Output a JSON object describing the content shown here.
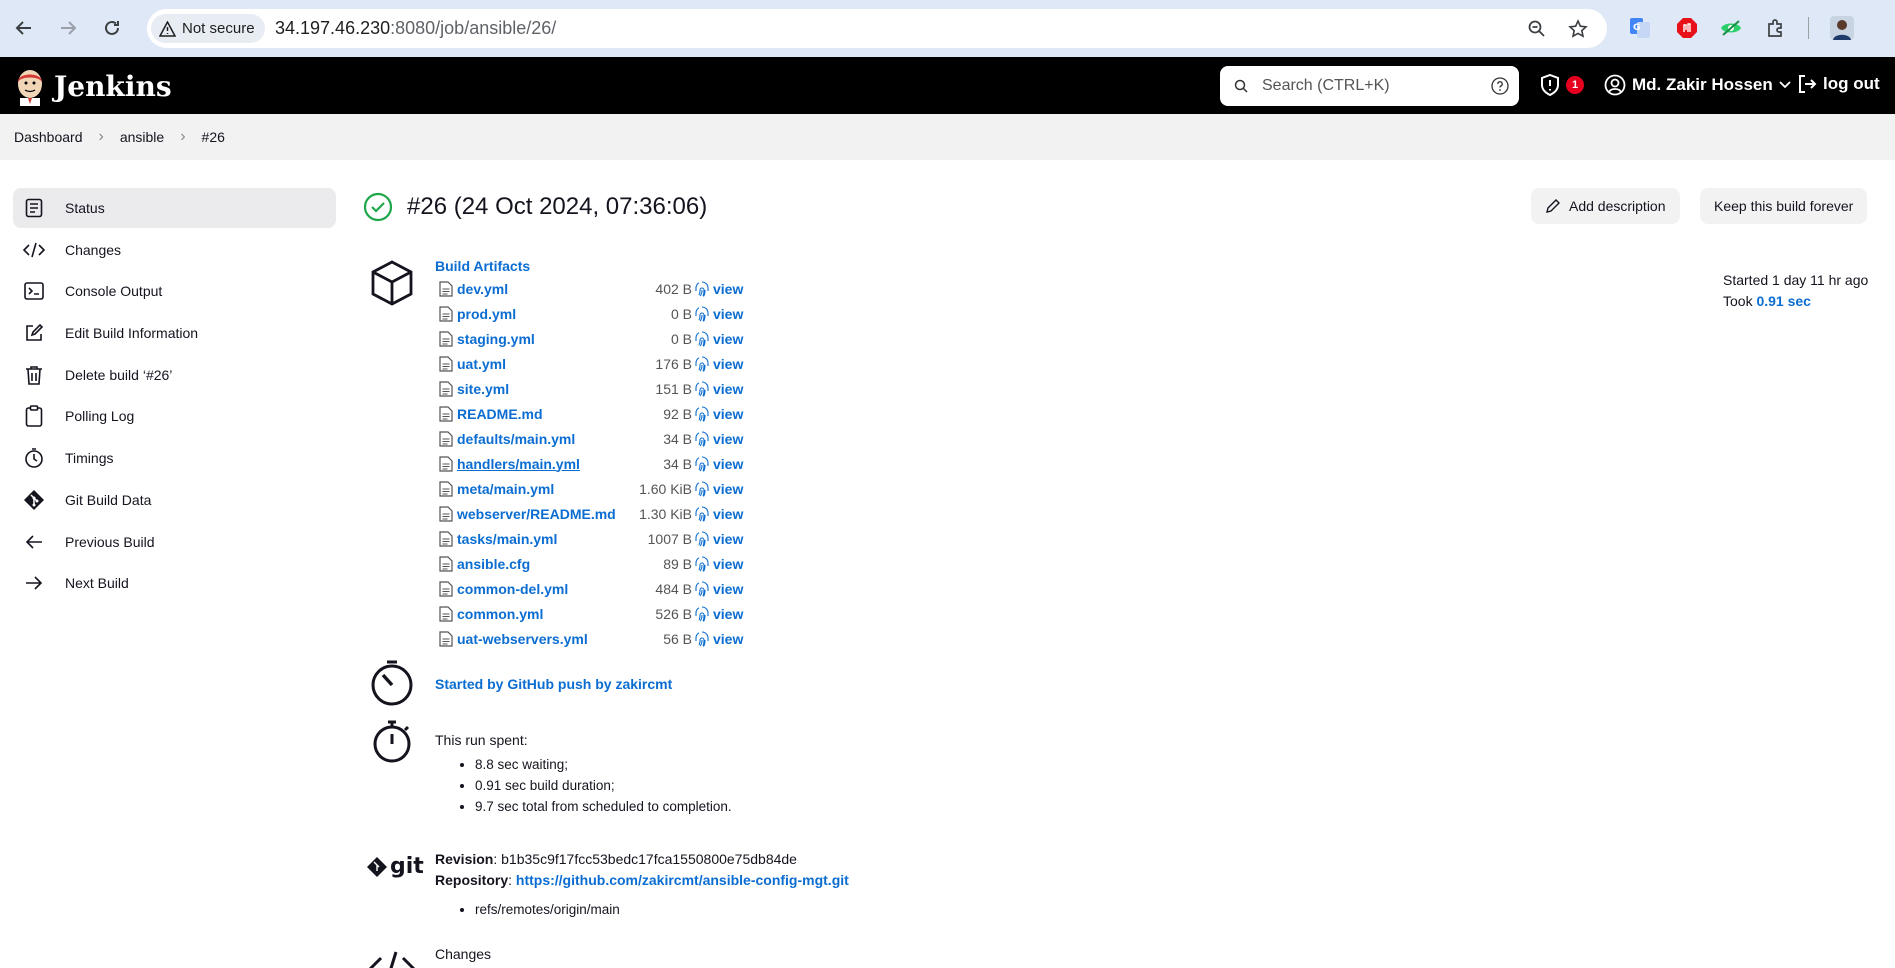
{
  "browser": {
    "security_label": "Not secure",
    "url_host": "34.197.46.230",
    "url_rest": ":8080/job/ansible/26/"
  },
  "header": {
    "brand": "Jenkins",
    "search_placeholder": "Search (CTRL+K)",
    "alert_count": "1",
    "user_name": "Md. Zakir Hossen",
    "logout_label": "log out"
  },
  "breadcrumb": [
    "Dashboard",
    "ansible",
    "#26"
  ],
  "sidebar": {
    "items": [
      {
        "label": "Status",
        "icon": "status-icon"
      },
      {
        "label": "Changes",
        "icon": "code-icon"
      },
      {
        "label": "Console Output",
        "icon": "terminal-icon"
      },
      {
        "label": "Edit Build Information",
        "icon": "edit-icon"
      },
      {
        "label": "Delete build ‘#26’",
        "icon": "trash-icon"
      },
      {
        "label": "Polling Log",
        "icon": "clipboard-icon"
      },
      {
        "label": "Timings",
        "icon": "stopwatch-icon"
      },
      {
        "label": "Git Build Data",
        "icon": "git-icon"
      },
      {
        "label": "Previous Build",
        "icon": "arrow-left-icon"
      },
      {
        "label": "Next Build",
        "icon": "arrow-right-icon"
      }
    ]
  },
  "build": {
    "title": "#26 (24 Oct 2024, 07:36:06)",
    "add_description": "Add description",
    "keep_forever": "Keep this build forever",
    "started_text": "Started 1 day 11 hr ago",
    "took_label": "Took",
    "took_value": "0.91 sec"
  },
  "artifacts": {
    "heading": "Build Artifacts",
    "view_label": "view",
    "files": [
      {
        "name": "dev.yml",
        "size": "402 B"
      },
      {
        "name": "prod.yml",
        "size": "0 B"
      },
      {
        "name": "staging.yml",
        "size": "0 B"
      },
      {
        "name": "uat.yml",
        "size": "176 B"
      },
      {
        "name": "site.yml",
        "size": "151 B"
      },
      {
        "name": "README.md",
        "size": "92 B"
      },
      {
        "name": "defaults/main.yml",
        "size": "34 B"
      },
      {
        "name": "handlers/main.yml",
        "size": "34 B"
      },
      {
        "name": "meta/main.yml",
        "size": "1.60 KiB"
      },
      {
        "name": "webserver/README.md",
        "size": "1.30 KiB"
      },
      {
        "name": "tasks/main.yml",
        "size": "1007 B"
      },
      {
        "name": "ansible.cfg",
        "size": "89 B"
      },
      {
        "name": "common-del.yml",
        "size": "484 B"
      },
      {
        "name": "common.yml",
        "size": "526 B"
      },
      {
        "name": "uat-webservers.yml",
        "size": "56 B"
      }
    ]
  },
  "cause": {
    "text": "Started by GitHub push by zakircmt"
  },
  "timing": {
    "heading": "This run spent:",
    "items": [
      "8.8 sec waiting;",
      "0.91 sec build duration;",
      "9.7 sec total from scheduled to completion."
    ]
  },
  "git": {
    "logo_text": "git",
    "revision_label": "Revision",
    "revision_value": "b1b35c9f17fcc53bedc17fca1550800e75db84de",
    "repository_label": "Repository",
    "repository_value": "https://github.com/zakircmt/ansible-config-mgt.git",
    "refs": [
      "refs/remotes/origin/main"
    ]
  },
  "changes": {
    "heading": "Changes"
  },
  "colors": {
    "accent": "#0b6dd2",
    "success": "#1ea64b",
    "header_bg": "#000000",
    "badge": "#e6001f"
  }
}
